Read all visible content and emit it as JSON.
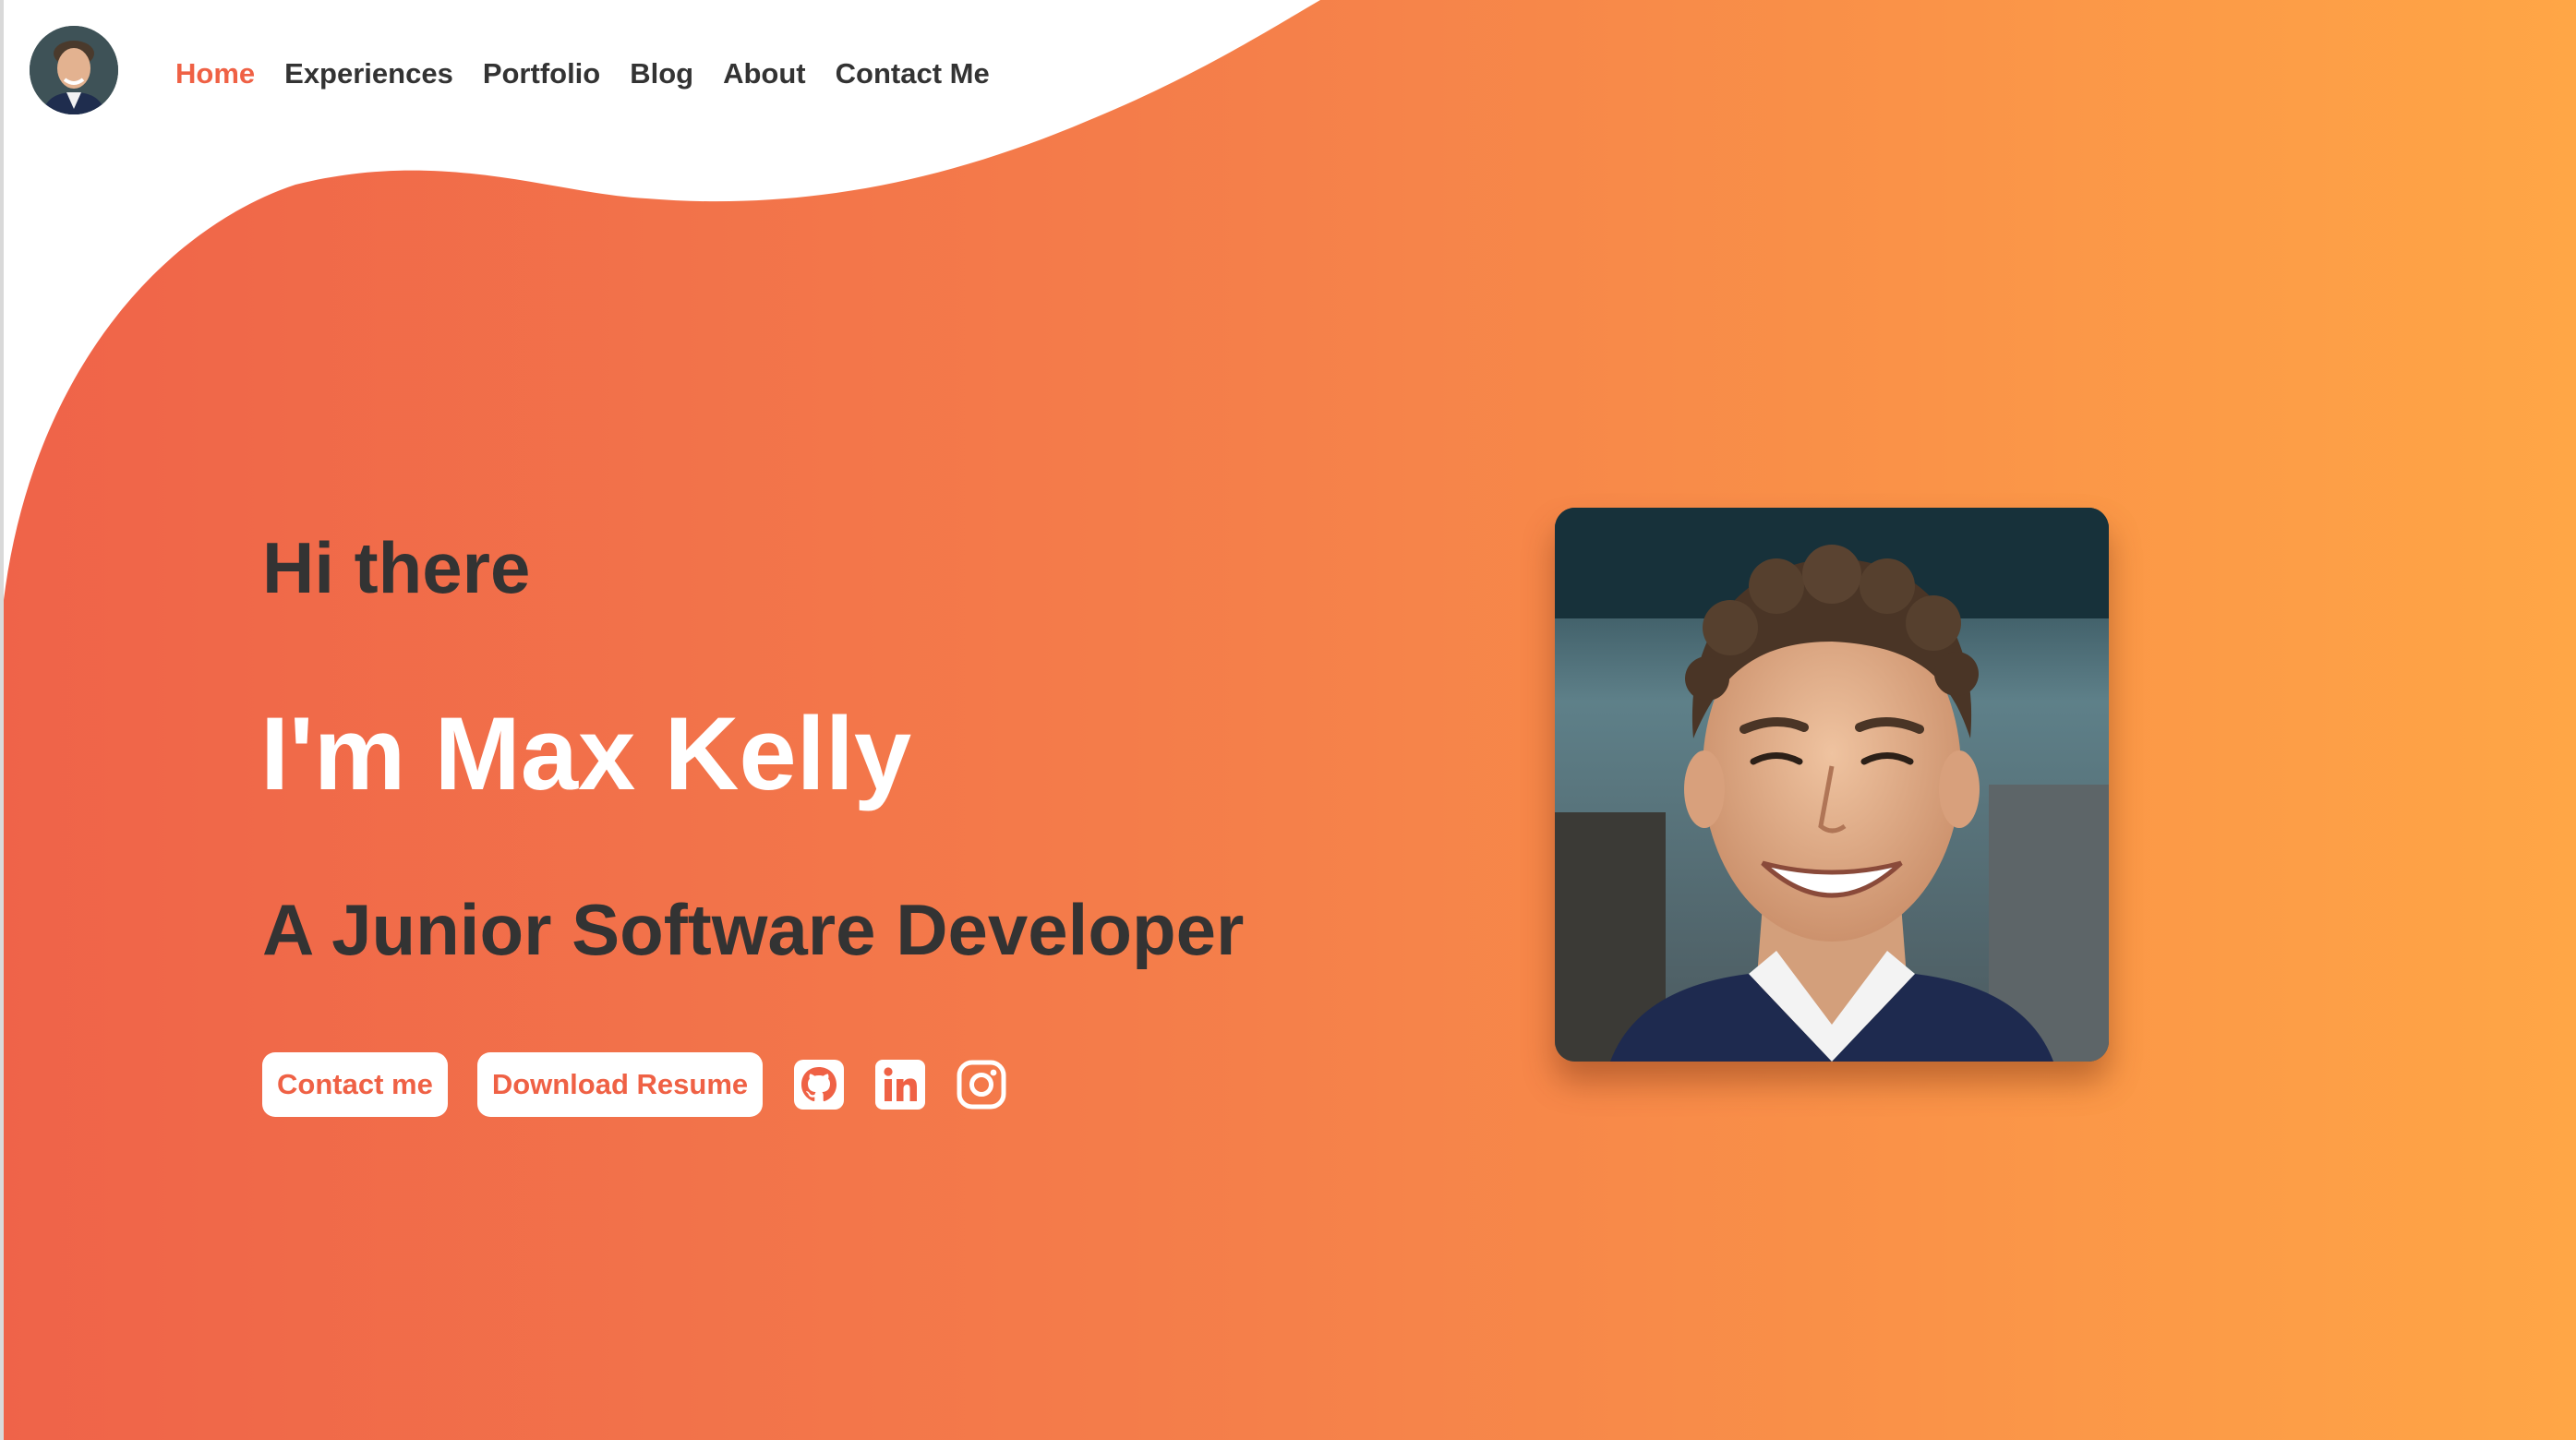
{
  "nav": {
    "avatar_alt": "Max Kelly avatar",
    "links": [
      {
        "label": "Home",
        "active": true
      },
      {
        "label": "Experiences",
        "active": false
      },
      {
        "label": "Portfolio",
        "active": false
      },
      {
        "label": "Blog",
        "active": false
      },
      {
        "label": "About",
        "active": false
      },
      {
        "label": "Contact Me",
        "active": false
      }
    ]
  },
  "hero": {
    "greeting": "Hi there",
    "name": "I'm Max Kelly",
    "role": "A Junior Software Developer",
    "buttons": {
      "contact": "Contact me",
      "resume": "Download Resume"
    },
    "social_icons": [
      "github-icon",
      "linkedin-icon",
      "instagram-icon"
    ],
    "portrait_alt": "Portrait photo of Max Kelly"
  },
  "colors": {
    "accent": "#ef6145",
    "gradient_start": "#ef6349",
    "gradient_end": "#ffa646",
    "text_dark": "#333333",
    "text_light": "#ffffff"
  }
}
